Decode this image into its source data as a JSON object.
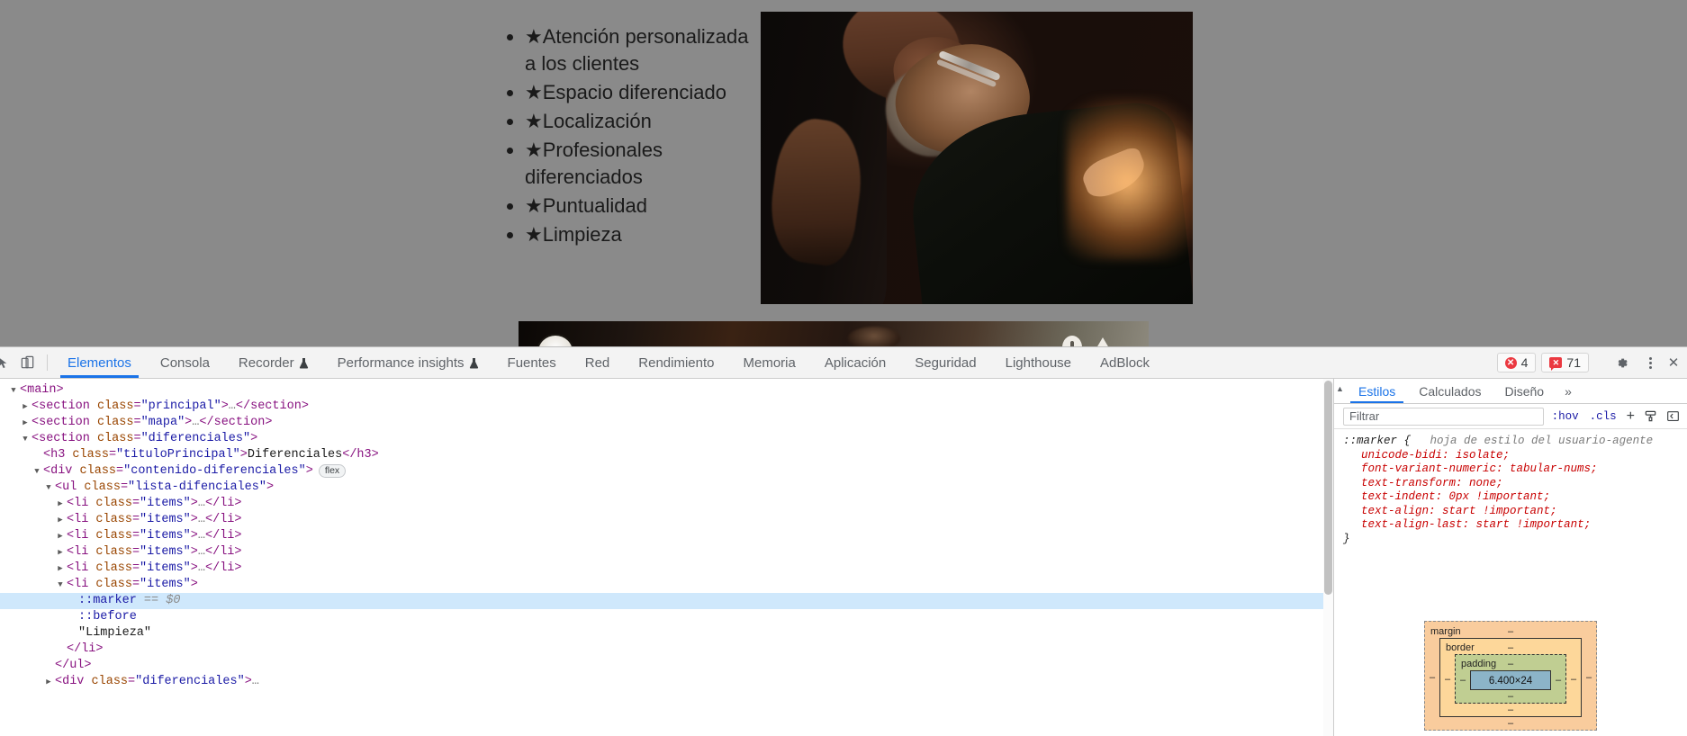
{
  "page": {
    "list_items": [
      "★Atención personalizada a los clientes",
      "★Espacio diferenciado",
      "★Localización",
      "★Profesionales diferenciados",
      "★Puntualidad",
      "★Limpieza"
    ],
    "photo_main_alt": "barber-shaving-client-photo",
    "photo_second_alt": "second-photo-partial"
  },
  "devtools": {
    "toolbar": {
      "inspect_icon": "inspect-element-icon",
      "device_icon": "device-toolbar-icon",
      "tabs": [
        {
          "label": "Elementos",
          "active": true,
          "beaker": false
        },
        {
          "label": "Consola",
          "active": false,
          "beaker": false
        },
        {
          "label": "Recorder",
          "active": false,
          "beaker": true
        },
        {
          "label": "Performance insights",
          "active": false,
          "beaker": true
        },
        {
          "label": "Fuentes",
          "active": false,
          "beaker": false
        },
        {
          "label": "Red",
          "active": false,
          "beaker": false
        },
        {
          "label": "Rendimiento",
          "active": false,
          "beaker": false
        },
        {
          "label": "Memoria",
          "active": false,
          "beaker": false
        },
        {
          "label": "Aplicación",
          "active": false,
          "beaker": false
        },
        {
          "label": "Seguridad",
          "active": false,
          "beaker": false
        },
        {
          "label": "Lighthouse",
          "active": false,
          "beaker": false
        },
        {
          "label": "AdBlock",
          "active": false,
          "beaker": false
        }
      ],
      "error_count": "4",
      "warning_count": "71",
      "error_glyph": "✕",
      "warning_glyph": "✕",
      "settings_icon": "gear-icon",
      "more_icon": "kebab-menu-icon",
      "close_icon": "close-icon",
      "close_glyph": "✕"
    },
    "dom_tree": [
      {
        "indent": 0,
        "twisty": "open",
        "html": "<span class=\"punct\">&lt;</span><span class=\"tag\">main</span><span class=\"punct\">&gt;</span>"
      },
      {
        "indent": 1,
        "twisty": "closed",
        "html": "<span class=\"punct\">&lt;</span><span class=\"tag\">section</span> <span class=\"attr\">class</span><span class=\"punct\">=</span><span class=\"val\">\"principal\"</span><span class=\"punct\">&gt;</span><span class=\"ell\">…</span><span class=\"punct\">&lt;/</span><span class=\"tag\">section</span><span class=\"punct\">&gt;</span>"
      },
      {
        "indent": 1,
        "twisty": "closed",
        "html": "<span class=\"punct\">&lt;</span><span class=\"tag\">section</span> <span class=\"attr\">class</span><span class=\"punct\">=</span><span class=\"val\">\"mapa\"</span><span class=\"punct\">&gt;</span><span class=\"ell\">…</span><span class=\"punct\">&lt;/</span><span class=\"tag\">section</span><span class=\"punct\">&gt;</span>"
      },
      {
        "indent": 1,
        "twisty": "open",
        "html": "<span class=\"punct\">&lt;</span><span class=\"tag\">section</span> <span class=\"attr\">class</span><span class=\"punct\">=</span><span class=\"val\">\"diferenciales\"</span><span class=\"punct\">&gt;</span>"
      },
      {
        "indent": 2,
        "twisty": "none",
        "html": "<span class=\"punct\">&lt;</span><span class=\"tag\">h3</span> <span class=\"attr\">class</span><span class=\"punct\">=</span><span class=\"val\">\"tituloPrincipal\"</span><span class=\"punct\">&gt;</span><span class=\"txt\">Diferenciales</span><span class=\"punct\">&lt;/</span><span class=\"tag\">h3</span><span class=\"punct\">&gt;</span>"
      },
      {
        "indent": 2,
        "twisty": "open",
        "html": "<span class=\"punct\">&lt;</span><span class=\"tag\">div</span> <span class=\"attr\">class</span><span class=\"punct\">=</span><span class=\"val\">\"contenido-diferenciales\"</span><span class=\"punct\">&gt;</span><span class=\"flexbadge\">flex</span>"
      },
      {
        "indent": 3,
        "twisty": "open",
        "html": "<span class=\"punct\">&lt;</span><span class=\"tag\">ul</span> <span class=\"attr\">class</span><span class=\"punct\">=</span><span class=\"val\">\"lista-difenciales\"</span><span class=\"punct\">&gt;</span>"
      },
      {
        "indent": 4,
        "twisty": "closed",
        "html": "<span class=\"punct\">&lt;</span><span class=\"tag\">li</span> <span class=\"attr\">class</span><span class=\"punct\">=</span><span class=\"val\">\"items\"</span><span class=\"punct\">&gt;</span><span class=\"ell\">…</span><span class=\"punct\">&lt;/</span><span class=\"tag\">li</span><span class=\"punct\">&gt;</span>"
      },
      {
        "indent": 4,
        "twisty": "closed",
        "html": "<span class=\"punct\">&lt;</span><span class=\"tag\">li</span> <span class=\"attr\">class</span><span class=\"punct\">=</span><span class=\"val\">\"items\"</span><span class=\"punct\">&gt;</span><span class=\"ell\">…</span><span class=\"punct\">&lt;/</span><span class=\"tag\">li</span><span class=\"punct\">&gt;</span>"
      },
      {
        "indent": 4,
        "twisty": "closed",
        "html": "<span class=\"punct\">&lt;</span><span class=\"tag\">li</span> <span class=\"attr\">class</span><span class=\"punct\">=</span><span class=\"val\">\"items\"</span><span class=\"punct\">&gt;</span><span class=\"ell\">…</span><span class=\"punct\">&lt;/</span><span class=\"tag\">li</span><span class=\"punct\">&gt;</span>"
      },
      {
        "indent": 4,
        "twisty": "closed",
        "html": "<span class=\"punct\">&lt;</span><span class=\"tag\">li</span> <span class=\"attr\">class</span><span class=\"punct\">=</span><span class=\"val\">\"items\"</span><span class=\"punct\">&gt;</span><span class=\"ell\">…</span><span class=\"punct\">&lt;/</span><span class=\"tag\">li</span><span class=\"punct\">&gt;</span>"
      },
      {
        "indent": 4,
        "twisty": "closed",
        "html": "<span class=\"punct\">&lt;</span><span class=\"tag\">li</span> <span class=\"attr\">class</span><span class=\"punct\">=</span><span class=\"val\">\"items\"</span><span class=\"punct\">&gt;</span><span class=\"ell\">…</span><span class=\"punct\">&lt;/</span><span class=\"tag\">li</span><span class=\"punct\">&gt;</span>"
      },
      {
        "indent": 4,
        "twisty": "open",
        "html": "<span class=\"punct\">&lt;</span><span class=\"tag\">li</span> <span class=\"attr\">class</span><span class=\"punct\">=</span><span class=\"val\">\"items\"</span><span class=\"punct\">&gt;</span>"
      },
      {
        "indent": 5,
        "twisty": "none",
        "selected": true,
        "html": "<span class=\"pseudo\">::marker</span> <span class=\"dollar\">== $0</span>"
      },
      {
        "indent": 5,
        "twisty": "none",
        "html": "<span class=\"pseudo\">::before</span>"
      },
      {
        "indent": 5,
        "twisty": "none",
        "html": "<span class=\"txt\">\"Limpieza\"</span>"
      },
      {
        "indent": 4,
        "twisty": "none",
        "html": "<span class=\"punct\">&lt;/</span><span class=\"tag\">li</span><span class=\"punct\">&gt;</span>"
      },
      {
        "indent": 3,
        "twisty": "none",
        "html": "<span class=\"punct\">&lt;/</span><span class=\"tag\">ul</span><span class=\"punct\">&gt;</span>"
      },
      {
        "indent": 3,
        "twisty": "closed",
        "html": "<span class=\"punct\">&lt;</span><span class=\"tag\">div</span> <span class=\"attr\">class</span><span class=\"punct\">=</span><span class=\"val\">\"diferenciales\"</span><span class=\"punct\">&gt;</span><span class=\"ell\">…</span>"
      }
    ],
    "styles": {
      "tabs": [
        {
          "label": "Estilos",
          "active": true
        },
        {
          "label": "Calculados",
          "active": false
        },
        {
          "label": "Diseño",
          "active": false
        }
      ],
      "more_glyph": "»",
      "collapse_glyph": "▲",
      "filter_placeholder": "Filtrar",
      "filter_value": "",
      "hov_label": ":hov",
      "cls_label": ".cls",
      "plus_label": "+",
      "brush_icon": "brush-icon",
      "sidebar_toggle_icon": "sidebar-toggle-icon",
      "rule": {
        "selector": "::marker {",
        "origin": "hoja de estilo del usuario-agente",
        "declarations": [
          {
            "prop": "unicode-bidi",
            "value": "isolate;"
          },
          {
            "prop": "font-variant-numeric",
            "value": "tabular-nums;"
          },
          {
            "prop": "text-transform",
            "value": "none;"
          },
          {
            "prop": "text-indent",
            "value": "0px !important;"
          },
          {
            "prop": "text-align",
            "value": "start !important;"
          },
          {
            "prop": "text-align-last",
            "value": "start !important;"
          }
        ],
        "close": "}"
      },
      "box_model": {
        "margin_label": "margin",
        "border_label": "border",
        "padding_label": "padding",
        "content_size": "6.400×24",
        "dash": "–"
      }
    }
  }
}
